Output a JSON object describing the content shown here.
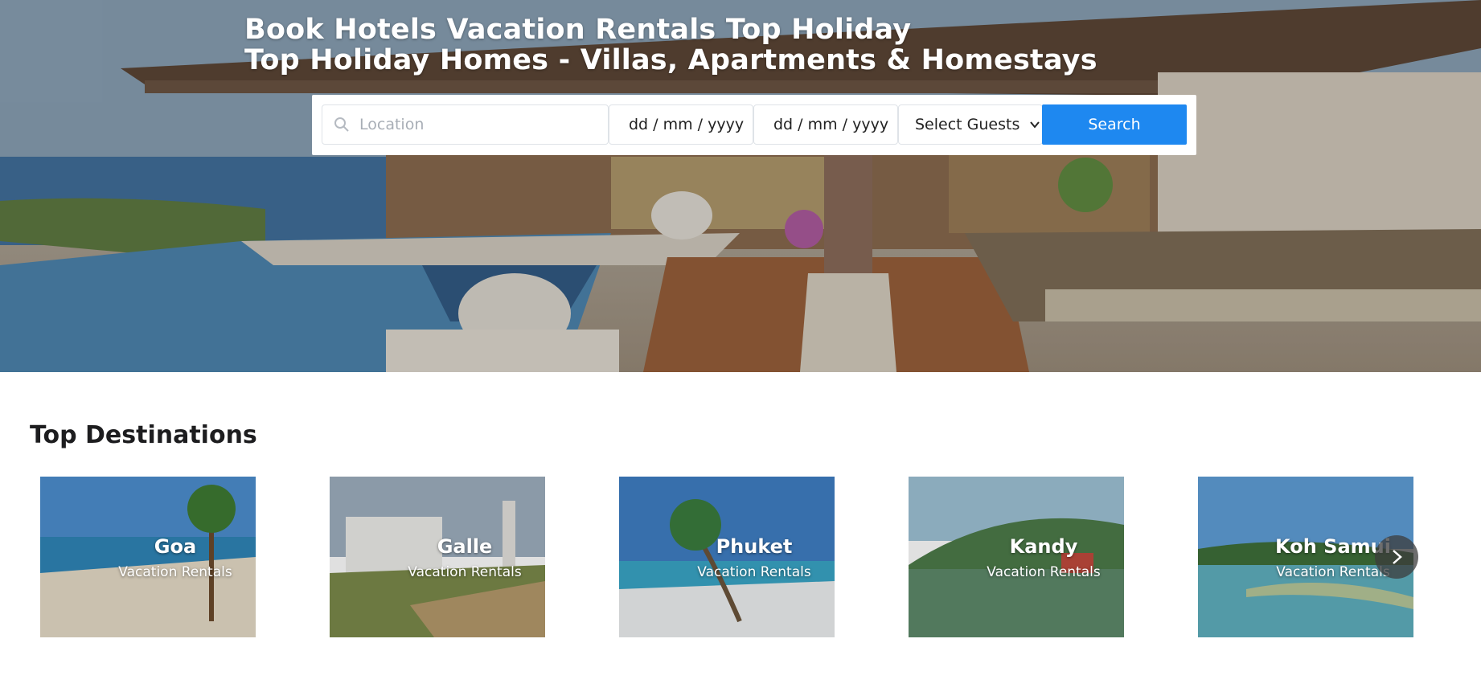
{
  "hero": {
    "title_line1": "Book Hotels Vacation Rentals Top Holiday",
    "title_line2": "Top Holiday Homes - Villas, Apartments & Homestays"
  },
  "search": {
    "location_placeholder": "Location",
    "checkin_value": "dd / mm / yyyy",
    "checkout_value": "dd / mm / yyyy",
    "guests_label": "Select Guests",
    "search_button": "Search",
    "accent_color": "#1e88f0"
  },
  "destinations": {
    "title": "Top Destinations",
    "items": [
      {
        "name": "Goa",
        "subtitle": "Vacation Rentals"
      },
      {
        "name": "Galle",
        "subtitle": "Vacation Rentals"
      },
      {
        "name": "Phuket",
        "subtitle": "Vacation Rentals"
      },
      {
        "name": "Kandy",
        "subtitle": "Vacation Rentals"
      },
      {
        "name": "Koh Samui",
        "subtitle": "Vacation Rentals"
      }
    ],
    "next_icon": "chevron-right-icon"
  }
}
